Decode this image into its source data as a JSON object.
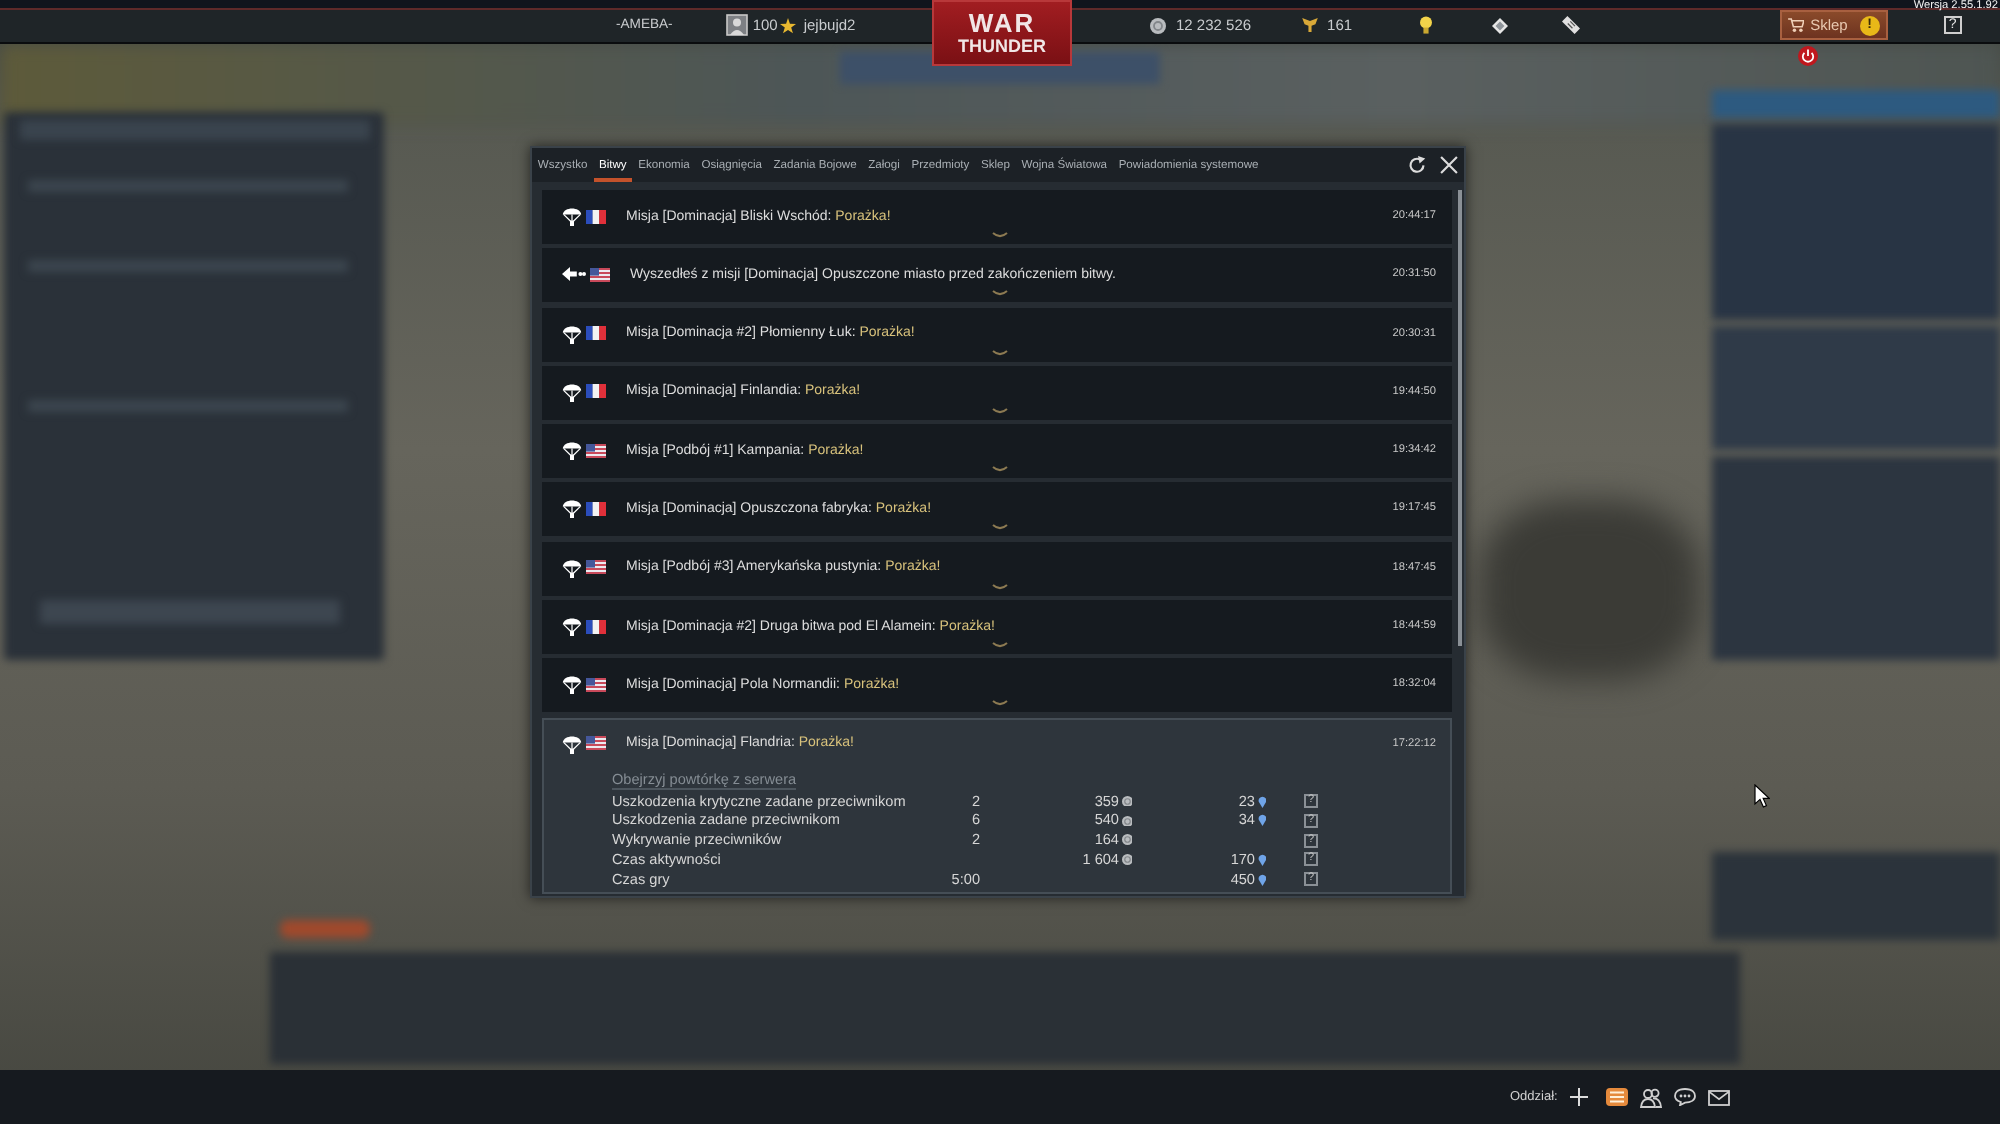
{
  "top_bar": {
    "squadron": "-AMEBA-",
    "rank": "100",
    "username": "jejbujd2",
    "logo": {
      "top": "WAR",
      "bottom": "THUNDER"
    },
    "silver_lions": "12 232 526",
    "golden_eagles": "161",
    "shop": {
      "label": "Sklep",
      "alert": "!"
    },
    "help": "?",
    "version": "Wersja 2.55.1.92"
  },
  "dialog": {
    "tabs": [
      {
        "label": "Wszystko",
        "selected": false
      },
      {
        "label": "Bitwy",
        "selected": true
      },
      {
        "label": "Ekonomia",
        "selected": false
      },
      {
        "label": "Osiągnięcia",
        "selected": false
      },
      {
        "label": "Zadania Bojowe",
        "selected": false
      },
      {
        "label": "Załogi",
        "selected": false
      },
      {
        "label": "Przedmioty",
        "selected": false
      },
      {
        "label": "Sklep",
        "selected": false
      },
      {
        "label": "Wojna Światowa",
        "selected": false
      },
      {
        "label": "Powiadomienia systemowe",
        "selected": false
      }
    ],
    "messages": [
      {
        "kind": "battle_result",
        "flag": {
          "kind": "france"
        },
        "text": "Misja [Dominacja] Bliski Wschód:",
        "result": "Porażka!",
        "time": "20:44:17",
        "expanded": false
      },
      {
        "kind": "left_battle",
        "flag": {
          "kind": "usa"
        },
        "text": "Wyszedłeś z misji [Dominacja] Opuszczone miasto przed zakończeniem bitwy.",
        "time": "20:31:50",
        "expanded": false
      },
      {
        "kind": "battle_result",
        "flag": {
          "kind": "france"
        },
        "text": "Misja [Dominacja #2] Płomienny Łuk:",
        "result": "Porażka!",
        "time": "20:30:31",
        "expanded": false
      },
      {
        "kind": "battle_result",
        "flag": {
          "kind": "france"
        },
        "text": "Misja [Dominacja] Finlandia:",
        "result": "Porażka!",
        "time": "19:44:50",
        "expanded": false
      },
      {
        "kind": "battle_result",
        "flag": {
          "kind": "usa"
        },
        "text": "Misja [Podbój #1] Kampania:",
        "result": "Porażka!",
        "time": "19:34:42",
        "expanded": false
      },
      {
        "kind": "battle_result",
        "flag": {
          "kind": "france"
        },
        "text": "Misja [Dominacja] Opuszczona fabryka:",
        "result": "Porażka!",
        "time": "19:17:45",
        "expanded": false
      },
      {
        "kind": "battle_result",
        "flag": {
          "kind": "usa"
        },
        "text": "Misja [Podbój #3] Amerykańska pustynia:",
        "result": "Porażka!",
        "time": "18:47:45",
        "expanded": false
      },
      {
        "kind": "battle_result",
        "flag": {
          "kind": "france"
        },
        "text": "Misja [Dominacja #2] Druga bitwa pod El Alamein:",
        "result": "Porażka!",
        "time": "18:44:59",
        "expanded": false
      },
      {
        "kind": "battle_result",
        "flag": {
          "kind": "usa"
        },
        "text": "Misja [Dominacja] Pola Normandii:",
        "result": "Porażka!",
        "time": "18:32:04",
        "expanded": false
      },
      {
        "kind": "battle_result",
        "flag": {
          "kind": "usa"
        },
        "text": "Misja [Dominacja] Flandria:",
        "result": "Porażka!",
        "time": "17:22:12",
        "expanded": true,
        "replay_link": "Obejrzyj powtórkę z serwera",
        "rewards": [
          {
            "label": "Uszkodzenia krytyczne zadane przeciwnikom",
            "count": "2",
            "silver": "359",
            "rp": "23",
            "help": "?"
          },
          {
            "label": "Uszkodzenia zadane przeciwnikom",
            "count": "6",
            "silver": "540",
            "rp": "34",
            "help": "?"
          },
          {
            "label": "Wykrywanie przeciwników",
            "count": "2",
            "silver": "164",
            "help": "?"
          },
          {
            "label": "Czas aktywności",
            "silver": "1 604",
            "rp": "170",
            "help": "?"
          },
          {
            "label": "Czas gry",
            "count": "5:00",
            "rp": "450",
            "help": "?"
          }
        ]
      }
    ]
  },
  "bottom_bar": {
    "squad_label": "Oddział:"
  }
}
